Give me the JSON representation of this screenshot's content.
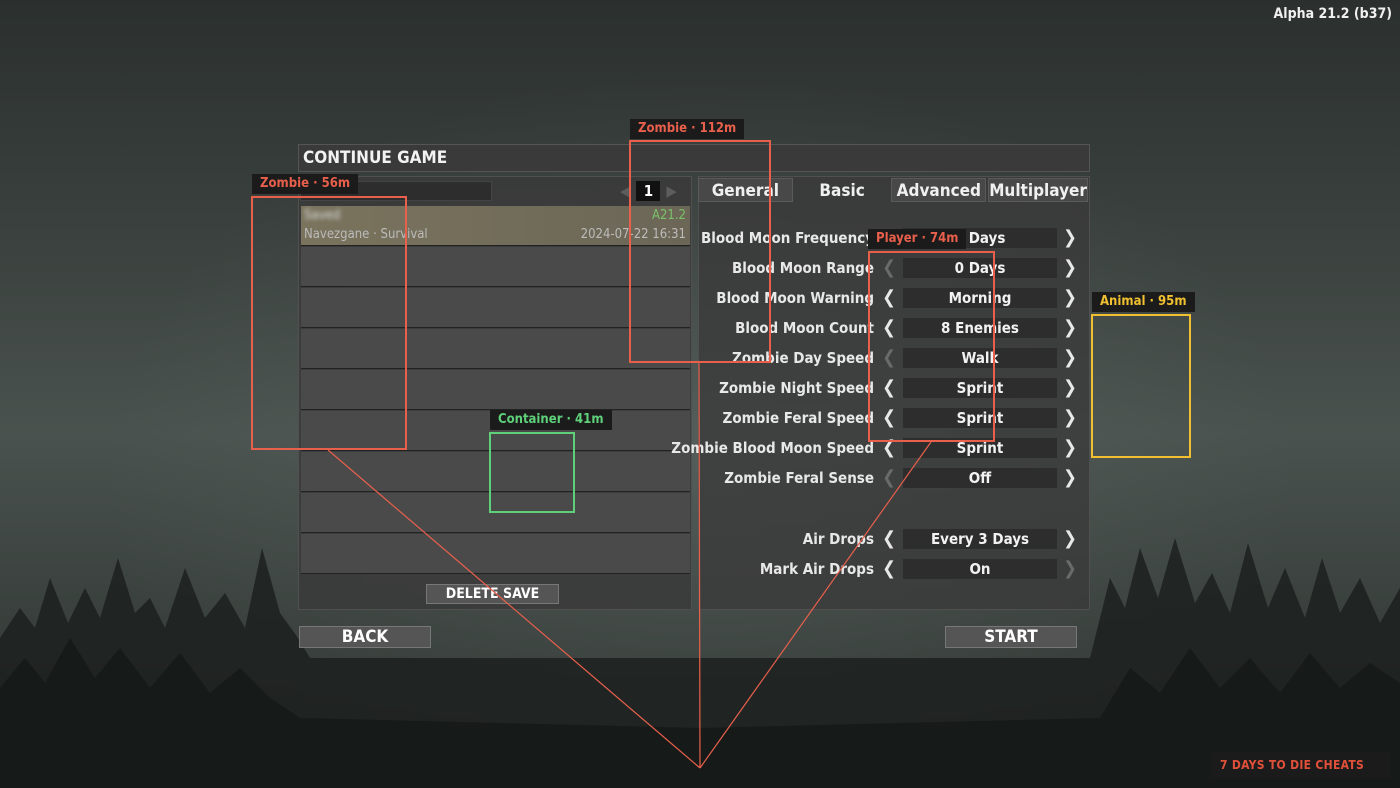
{
  "version": "Alpha 21.2 (b37)",
  "window_title": "CONTINUE GAME",
  "pager": {
    "prev": "◀",
    "page": "1",
    "next": "▶"
  },
  "saves": [
    {
      "name": "Saved",
      "version": "A21.2",
      "world": "Navezgane · Survival",
      "date": "2024-07-22 16:31"
    }
  ],
  "buttons": {
    "delete": "DELETE SAVE",
    "back": "BACK",
    "start": "START"
  },
  "tabs": [
    "General",
    "Basic",
    "Advanced",
    "Multiplayer"
  ],
  "active_tab": "Basic",
  "options": [
    {
      "label": "Blood Moon Frequency",
      "value": "7 Days",
      "left_enabled": true,
      "right_enabled": true
    },
    {
      "label": "Blood Moon Range",
      "value": "0 Days",
      "left_enabled": false,
      "right_enabled": true
    },
    {
      "label": "Blood Moon Warning",
      "value": "Morning",
      "left_enabled": true,
      "right_enabled": true
    },
    {
      "label": "Blood Moon Count",
      "value": "8 Enemies",
      "left_enabled": true,
      "right_enabled": true
    },
    {
      "label": "Zombie Day Speed",
      "value": "Walk",
      "left_enabled": false,
      "right_enabled": true
    },
    {
      "label": "Zombie Night Speed",
      "value": "Sprint",
      "left_enabled": true,
      "right_enabled": true
    },
    {
      "label": "Zombie Feral Speed",
      "value": "Sprint",
      "left_enabled": true,
      "right_enabled": true
    },
    {
      "label": "Zombie Blood Moon Speed",
      "value": "Sprint",
      "left_enabled": true,
      "right_enabled": true
    },
    {
      "label": "Zombie Feral Sense",
      "value": "Off",
      "left_enabled": false,
      "right_enabled": true
    },
    {
      "label": "Air Drops",
      "value": "Every 3 Days",
      "left_enabled": true,
      "right_enabled": true
    },
    {
      "label": "Mark Air Drops",
      "value": "On",
      "left_enabled": true,
      "right_enabled": false
    }
  ],
  "esp": [
    {
      "label": "Zombie · 56m",
      "kind": "zombie",
      "color": "#e8604c"
    },
    {
      "label": "Zombie · 112m",
      "kind": "zombie",
      "color": "#e8604c"
    },
    {
      "label": "Player · 74m",
      "kind": "player",
      "color": "#e8604c"
    },
    {
      "label": "Animal · 95m",
      "kind": "animal",
      "color": "#f0c030"
    },
    {
      "label": "Container · 41m",
      "kind": "container",
      "color": "#5fd07a"
    }
  ],
  "watermark": "7 DAYS TO DIE CHEATS",
  "colors": {
    "zombie": "#e8604c",
    "animal": "#f0c030",
    "container": "#5fd07a",
    "accent_version": "#7ac06a"
  }
}
